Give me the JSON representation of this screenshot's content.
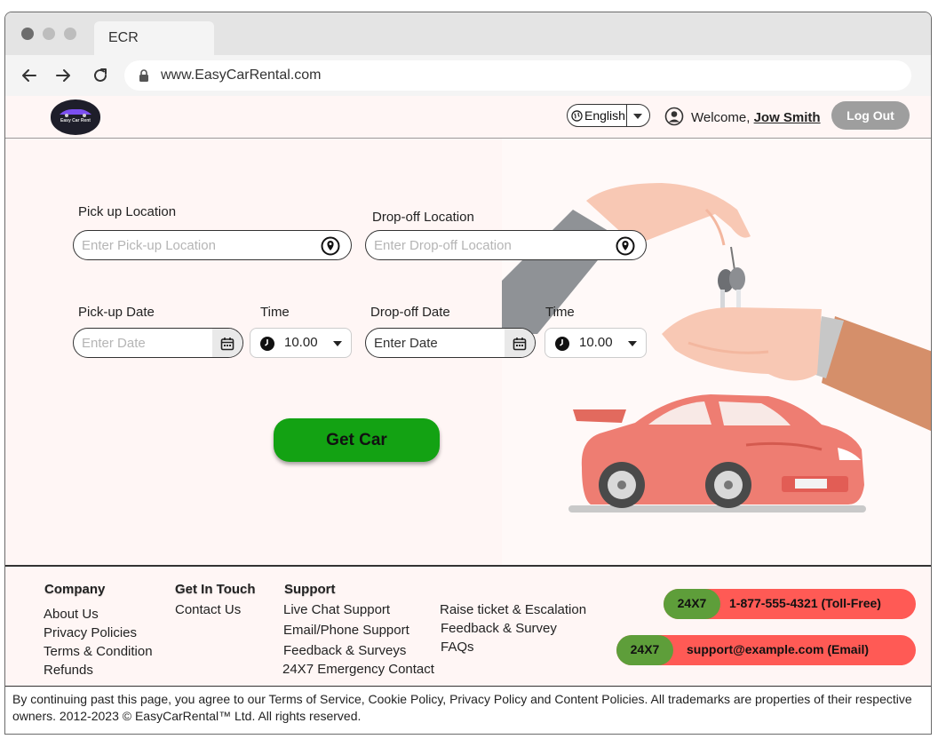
{
  "browser": {
    "tab_title": "ECR",
    "url": "www.EasyCarRental.com"
  },
  "header": {
    "logo_text": "Easy Car Rent",
    "language": "English",
    "welcome_prefix": "Welcome, ",
    "user_name": "Jow Smith",
    "logout_label": "Log Out"
  },
  "form": {
    "pickup_location_label": "Pick up Location",
    "pickup_location_placeholder": "Enter Pick-up Location",
    "dropoff_location_label": "Drop-off Location",
    "dropoff_location_placeholder": "Enter Drop-off Location",
    "pickup_date_label": "Pick-up Date",
    "pickup_date_placeholder": "Enter Date",
    "pickup_time_label": "Time",
    "pickup_time_value": "10.00",
    "dropoff_date_label": "Drop-off Date",
    "dropoff_date_placeholder": "Enter Date",
    "dropoff_time_label": "Time",
    "dropoff_time_value": "10.00",
    "submit_label": "Get Car"
  },
  "footer": {
    "company": {
      "heading": "Company",
      "links": [
        "About Us",
        "Privacy Policies",
        "Terms & Condition",
        "Refunds"
      ]
    },
    "contact": {
      "heading": "Get In Touch",
      "links": [
        "Contact Us"
      ]
    },
    "support": {
      "heading": "Support",
      "links": [
        "Live Chat Support",
        "Email/Phone Support",
        "Feedback & Surveys",
        "24X7 Emergency Contact"
      ],
      "links_col2": [
        "Raise ticket & Escalation",
        "Feedback & Survey",
        "FAQs"
      ]
    },
    "phone": {
      "tag": "24X7",
      "text": "1-877-555-4321 (Toll-Free)"
    },
    "email": {
      "tag": "24X7",
      "text": "support@example.com (Email)"
    },
    "legal": "By continuing past this page, you agree to our Terms of Service, Cookie Policy, Privacy Policy and Content Policies. All trademarks are properties of their respective owners. 2012-2023 © EasyCarRental™ Ltd. All rights reserved."
  },
  "colors": {
    "accent_green": "#13a213",
    "pill_red": "#ff5a55",
    "pill_green": "#5e9e3a",
    "logout_gray": "#9e9e9e",
    "page_bg": "#fff6f5"
  }
}
